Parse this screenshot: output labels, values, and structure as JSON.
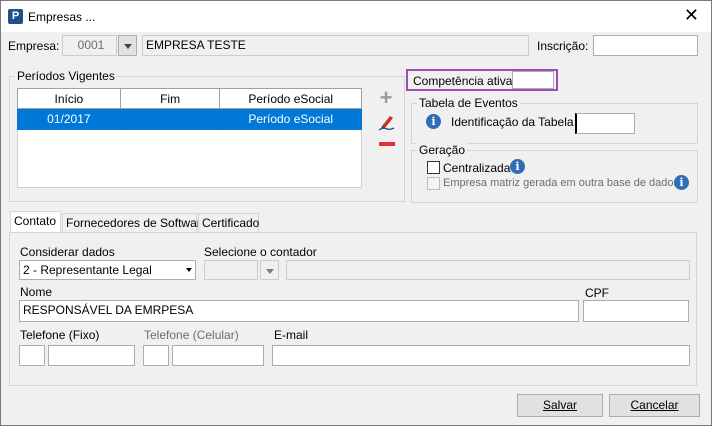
{
  "window": {
    "title": "Empresas ...",
    "close_glyph": "✕"
  },
  "empresa": {
    "label": "Empresa:",
    "code": "0001",
    "name": "EMPRESA TESTE",
    "inscricao_label": "Inscrição:",
    "inscricao_value": ""
  },
  "periodos": {
    "title": "Períodos Vigentes",
    "columns": [
      "Início",
      "Fim",
      "Período eSocial"
    ],
    "rows": [
      {
        "inicio": "01/2017",
        "fim": "",
        "periodo": "Período eSocial"
      }
    ]
  },
  "competencia": {
    "label": "Competência ativa:",
    "value": ""
  },
  "tabela_eventos": {
    "title": "Tabela de Eventos",
    "label": "Identificação da Tabela",
    "value": ""
  },
  "geracao": {
    "title": "Geração",
    "centralizada": "Centralizada",
    "matriz": "Empresa matriz gerada em outra base de dados"
  },
  "tabs": [
    "Contato",
    "Fornecedores de Software",
    "Certificado"
  ],
  "contato": {
    "considerar_label": "Considerar dados",
    "considerar_value": "2 - Representante Legal",
    "contador_label": "Selecione o contador",
    "nome_label": "Nome",
    "nome_value": "RESPONSÁVEL DA EMRPESA",
    "cpf_label": "CPF",
    "telefone_fixo_label": "Telefone (Fixo)",
    "telefone_celular_label": "Telefone (Celular)",
    "email_label": "E-mail"
  },
  "buttons": {
    "salvar": "Salvar",
    "cancelar": "Cancelar"
  },
  "icons": {
    "app": "P",
    "info": "i",
    "add": "+",
    "remove": "−"
  },
  "colors": {
    "selection": "#0078d7",
    "highlight_border": "#9b4fb6",
    "app_icon": "#1e4f8f",
    "remove_red": "#e0312c"
  }
}
